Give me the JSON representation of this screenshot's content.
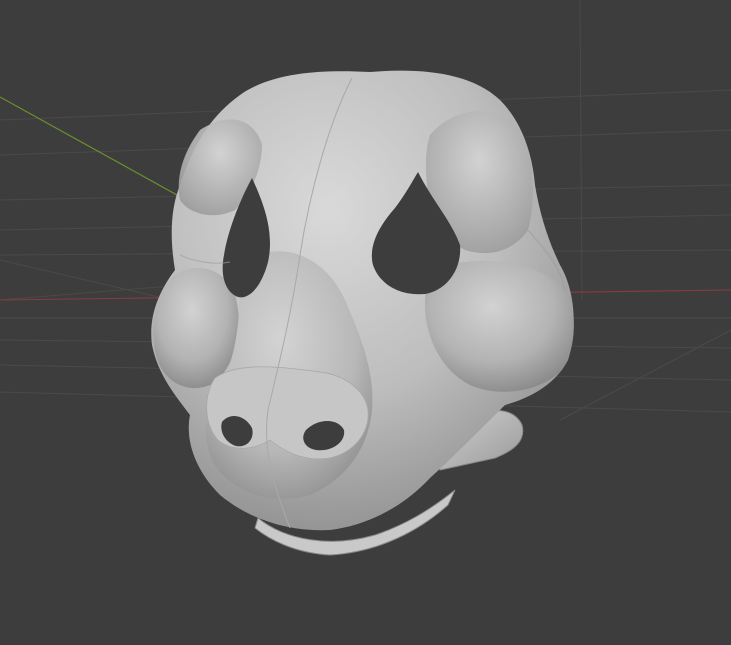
{
  "viewport": {
    "mode": "3d-viewport",
    "background_color": "#3d3d3d",
    "grid_color": "#4a4a4a",
    "x_axis_color": "#8a3a42",
    "y_axis_color": "#6b8f2e",
    "model": {
      "name": "mask",
      "surface_color": "#bdbdbd",
      "shadow_color": "#7f7f7f",
      "highlight_color": "#d6d6d6",
      "hole_color": "#3d3d3d"
    }
  }
}
